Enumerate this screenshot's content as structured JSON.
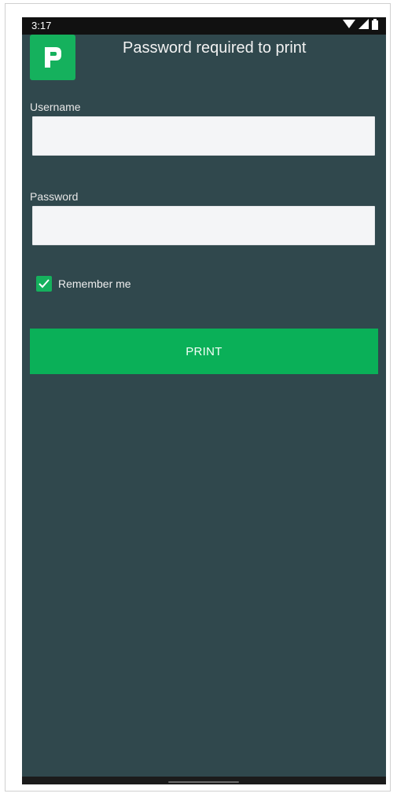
{
  "status_bar": {
    "time": "3:17",
    "icons": [
      "wifi-icon",
      "signal-icon",
      "battery-icon"
    ]
  },
  "header": {
    "logo_icon": "papercut-logo-icon",
    "title": "Password required to print"
  },
  "form": {
    "username_label": "Username",
    "username_value": "",
    "password_label": "Password",
    "password_value": "",
    "remember_label": "Remember me",
    "remember_checked": true,
    "print_label": "PRINT"
  },
  "colors": {
    "background": "#30484d",
    "accent": "#15b15d",
    "input_background": "#f4f5f7"
  }
}
